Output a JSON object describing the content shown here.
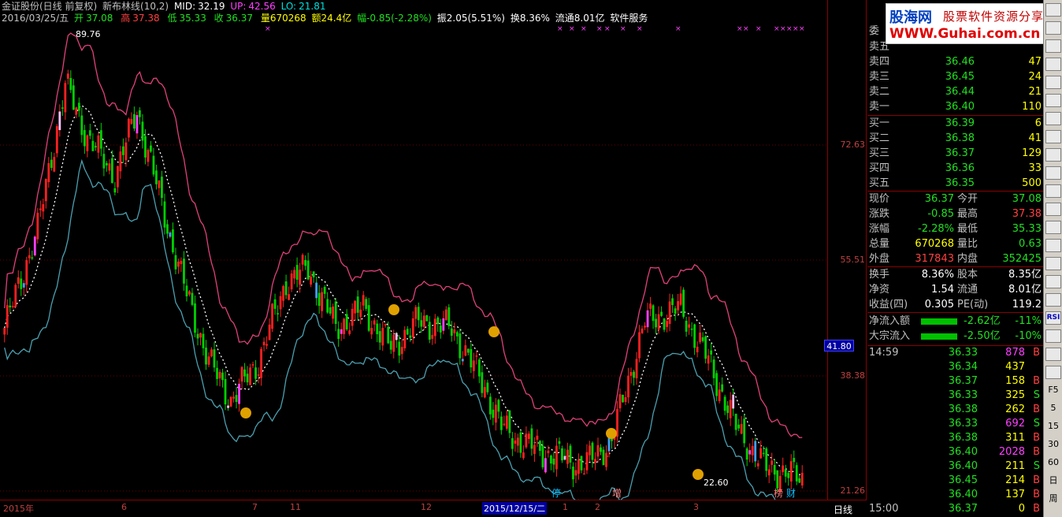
{
  "header": {
    "stock": "金证股份(日线 前复权)",
    "indicator": "新布林线(10,2)",
    "mid_label": "MID:",
    "mid_value": "32.19",
    "up_label": "UP:",
    "up_value": "42.56",
    "lo_label": "LO:",
    "lo_value": "21.81",
    "date": "2016/03/25/五",
    "open_label": "开",
    "open": "37.08",
    "high_label": "高",
    "high": "37.38",
    "low_label": "低",
    "low": "35.33",
    "close_label": "收",
    "close": "36.37",
    "volume": "量670268",
    "amount": "额24.4亿",
    "change": "幅-0.85(-2.28%)",
    "amplitude": "振2.05(5.51%)",
    "turnover": "换8.36%",
    "float": "流通8.01亿",
    "sector": "软件服务"
  },
  "price_axis": {
    "labels": [
      "72.63",
      "55.51",
      "38.38",
      "21.26"
    ],
    "current": "41.80"
  },
  "chart_marks": {
    "high_marker": "89.76",
    "low_marker": "22.60",
    "flags": [
      {
        "text": "停",
        "color": "#00c0ff"
      },
      {
        "text": "增",
        "color": "#ff8080"
      },
      {
        "text": "榜",
        "color": "#ff8080"
      },
      {
        "text": "财",
        "color": "#00c0ff"
      }
    ]
  },
  "time_axis": {
    "labels": [
      "2015年",
      "6",
      "7",
      "11",
      "12",
      "2015/12/15/二",
      "1",
      "2",
      "3"
    ],
    "period": "日线"
  },
  "logo": {
    "brand": "股海网",
    "slogan": "股票软件资源分享",
    "url": "WWW.Guhai.com.cn"
  },
  "order_book": {
    "committee_label": "委",
    "sells": [
      {
        "label": "卖五",
        "price": "",
        "vol": ""
      },
      {
        "label": "卖四",
        "price": "36.46",
        "vol": "47"
      },
      {
        "label": "卖三",
        "price": "36.45",
        "vol": "24"
      },
      {
        "label": "卖二",
        "price": "36.44",
        "vol": "21"
      },
      {
        "label": "卖一",
        "price": "36.40",
        "vol": "110"
      }
    ],
    "buys": [
      {
        "label": "买一",
        "price": "36.39",
        "vol": "6"
      },
      {
        "label": "买二",
        "price": "36.38",
        "vol": "41"
      },
      {
        "label": "买三",
        "price": "36.37",
        "vol": "129"
      },
      {
        "label": "买四",
        "price": "36.36",
        "vol": "33"
      },
      {
        "label": "买五",
        "price": "36.35",
        "vol": "500"
      }
    ]
  },
  "stats": [
    {
      "l1": "现价",
      "v1": "36.37",
      "c1": "#20e020",
      "l2": "今开",
      "v2": "37.08",
      "c2": "#20e020"
    },
    {
      "l1": "涨跌",
      "v1": "-0.85",
      "c1": "#20e020",
      "l2": "最高",
      "v2": "37.38",
      "c2": "#ff4040"
    },
    {
      "l1": "涨幅",
      "v1": "-2.28%",
      "c1": "#20e020",
      "l2": "最低",
      "v2": "35.33",
      "c2": "#20e020"
    },
    {
      "l1": "总量",
      "v1": "670268",
      "c1": "#ffff00",
      "l2": "量比",
      "v2": "0.63",
      "c2": "#20e020"
    },
    {
      "l1": "外盘",
      "v1": "317843",
      "c1": "#ff4040",
      "l2": "内盘",
      "v2": "352425",
      "c2": "#20e020"
    }
  ],
  "fundamentals": [
    {
      "l1": "换手",
      "v1": "8.36%",
      "l2": "股本",
      "v2": "8.35亿"
    },
    {
      "l1": "净资",
      "v1": "1.54",
      "l2": "流通",
      "v2": "8.01亿"
    },
    {
      "l1": "收益(四)",
      "v1": "0.305",
      "l2": "PE(动)",
      "v2": "119.2"
    }
  ],
  "flows": [
    {
      "label": "净流入额",
      "value": "-2.62亿",
      "pct": "-11%"
    },
    {
      "label": "大宗流入",
      "value": "-2.50亿",
      "pct": "-10%"
    }
  ],
  "ticks": [
    {
      "t": "14:59",
      "p": "36.33",
      "v": "878",
      "d": "B",
      "vc": "#ff40ff"
    },
    {
      "t": "",
      "p": "36.34",
      "v": "437",
      "d": "",
      "vc": "#ffff00"
    },
    {
      "t": "",
      "p": "36.37",
      "v": "158",
      "d": "B",
      "vc": "#ffff00"
    },
    {
      "t": "",
      "p": "36.33",
      "v": "325",
      "d": "S",
      "vc": "#ffff00"
    },
    {
      "t": "",
      "p": "36.38",
      "v": "262",
      "d": "B",
      "vc": "#ffff00"
    },
    {
      "t": "",
      "p": "36.33",
      "v": "692",
      "d": "S",
      "vc": "#ff40ff"
    },
    {
      "t": "",
      "p": "36.38",
      "v": "311",
      "d": "B",
      "vc": "#ffff00"
    },
    {
      "t": "",
      "p": "36.40",
      "v": "2028",
      "d": "B",
      "vc": "#ff40ff"
    },
    {
      "t": "",
      "p": "36.40",
      "v": "211",
      "d": "S",
      "vc": "#ffff00"
    },
    {
      "t": "",
      "p": "36.45",
      "v": "214",
      "d": "B",
      "vc": "#ffff00"
    },
    {
      "t": "",
      "p": "36.40",
      "v": "137",
      "d": "B",
      "vc": "#ffff00"
    },
    {
      "t": "15:00",
      "p": "36.37",
      "v": "0",
      "d": "B",
      "vc": "#ffff00"
    }
  ],
  "toolbar": {
    "buttons": [
      "",
      "",
      "",
      "",
      "",
      "",
      "",
      "",
      "",
      "",
      "",
      "",
      "",
      "",
      "",
      "",
      "",
      "RSI",
      "",
      "",
      "",
      "F5",
      "5",
      "15",
      "30",
      "60",
      "日",
      "周"
    ]
  },
  "colors": {
    "up": "#ff2020",
    "down": "#00d000",
    "band_up": "#e0407a",
    "band_lo": "#4aa0b0",
    "mid": "#ffffff"
  }
}
